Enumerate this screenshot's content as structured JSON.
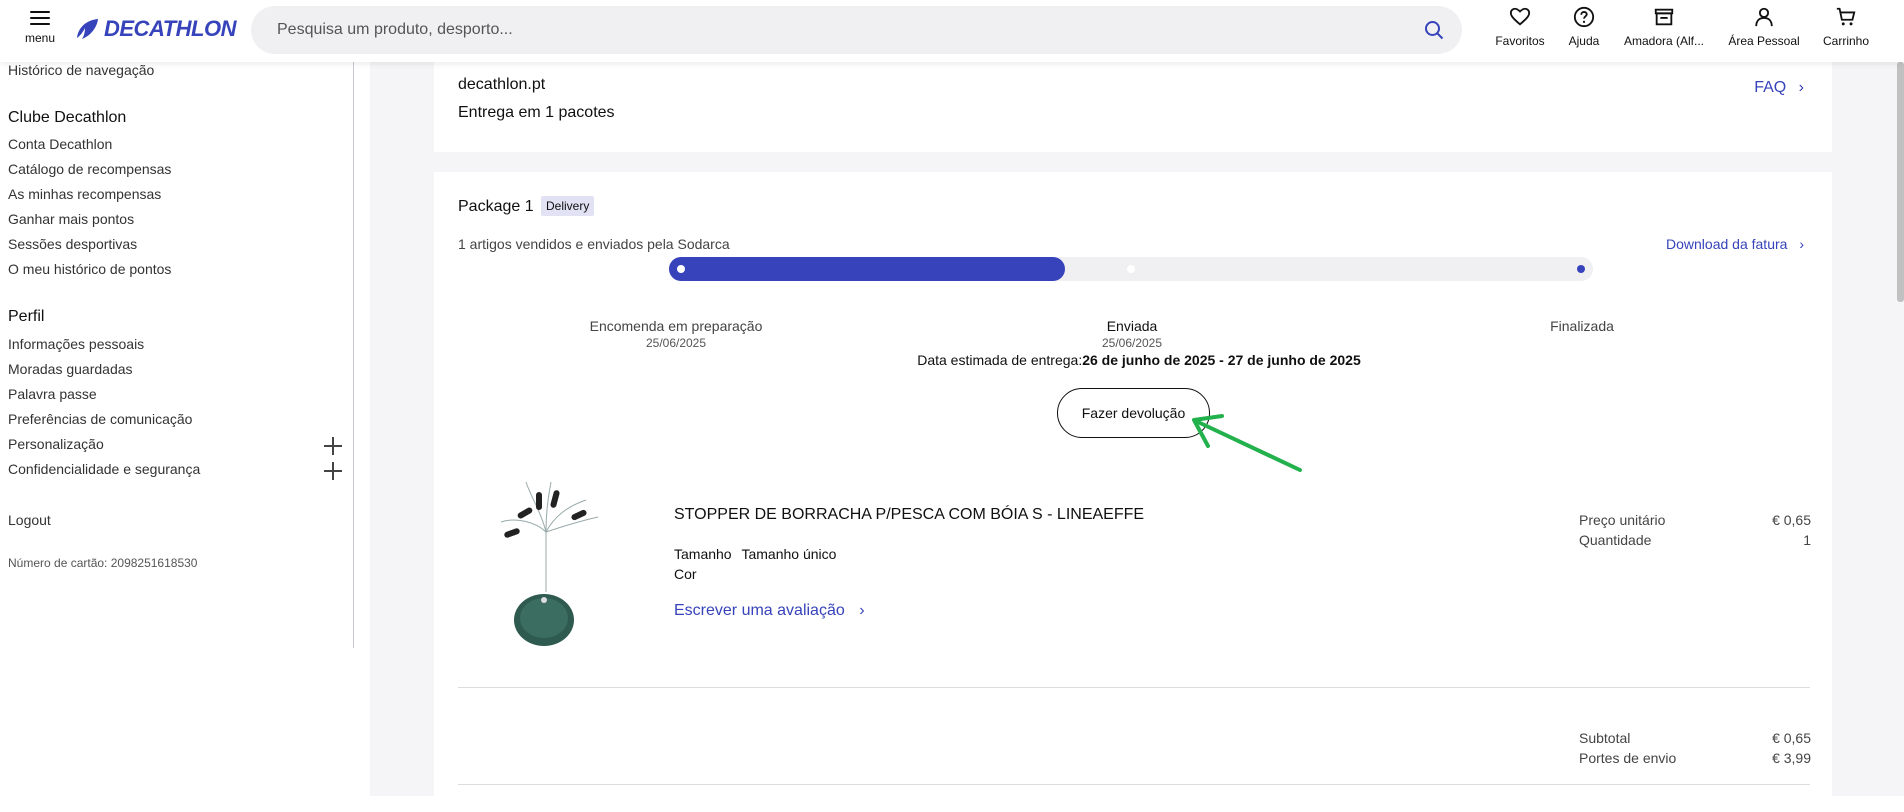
{
  "header": {
    "menu_label": "menu",
    "logo_text": "DECATHLON",
    "search_placeholder": "Pesquisa um produto, desporto...",
    "nav": [
      {
        "label": "Favoritos",
        "icon": "heart-icon"
      },
      {
        "label": "Ajuda",
        "icon": "help-icon"
      },
      {
        "label": "Amadora (Alf...",
        "icon": "store-icon"
      },
      {
        "label": "Área Pessoal",
        "icon": "user-icon"
      },
      {
        "label": "Carrinho",
        "icon": "cart-icon"
      }
    ]
  },
  "sidebar": {
    "history": "Histórico de navegação",
    "club_heading": "Clube Decathlon",
    "club_items": [
      "Conta Decathlon",
      "Catálogo de recompensas",
      "As minhas recompensas",
      "Ganhar mais pontos",
      "Sessões desportivas",
      "O meu histórico de pontos"
    ],
    "profile_heading": "Perfil",
    "profile_items": [
      "Informações pessoais",
      "Moradas guardadas",
      "Palavra passe",
      "Preferências de comunicação",
      "Personalização",
      "Confidencialidade e segurança"
    ],
    "logout": "Logout",
    "card_number": "Número de cartão: 2098251618530"
  },
  "order": {
    "seller": "decathlon.pt",
    "delivery_count": "Entrega em 1 pacotes",
    "faq": "FAQ"
  },
  "package": {
    "title": "Package 1",
    "badge": "Delivery",
    "sold_by": "1 artigos vendidos e enviados pela Sodarca",
    "invoice": "Download da fatura",
    "progress": 0.5,
    "steps": [
      {
        "label": "Encomenda em preparação",
        "date": "25/06/2025"
      },
      {
        "label": "Enviada",
        "date": "25/06/2025"
      },
      {
        "label": "Finalizada",
        "date": ""
      }
    ],
    "eta_label": "Data estimada de entrega:",
    "eta_value": "26 de junho de 2025 - 27 de junho de 2025",
    "return_button": "Fazer devolução",
    "product": {
      "name": "STOPPER DE BORRACHA P/PESCA COM BÓIA S - LINEAEFFE",
      "size_label": "Tamanho",
      "size_value": "Tamanho único",
      "color_label": "Cor",
      "review": "Escrever uma avaliação",
      "unit_price_label": "Preço unitário",
      "unit_price": "€ 0,65",
      "quantity_label": "Quantidade",
      "quantity": "1"
    },
    "totals": {
      "subtotal_label": "Subtotal",
      "subtotal": "€ 0,65",
      "shipping_label": "Portes de envio",
      "shipping": "€ 3,99"
    }
  },
  "colors": {
    "brand": "#3643ba",
    "annotation_arrow": "#22b14c"
  }
}
